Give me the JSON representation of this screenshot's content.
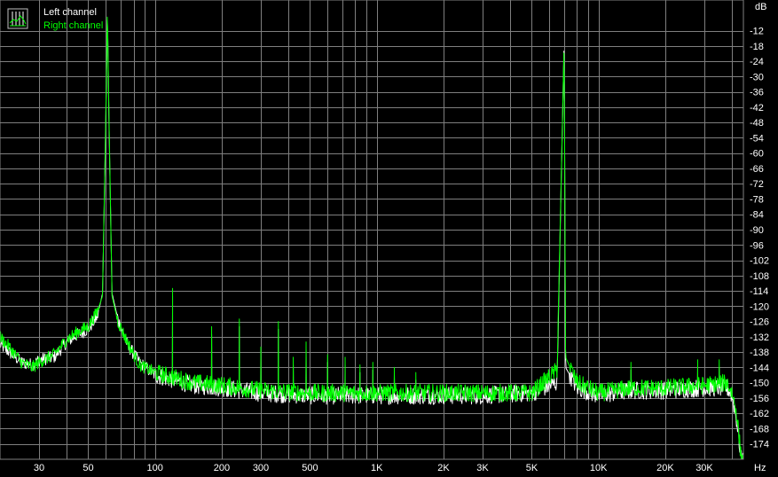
{
  "chart_data": {
    "type": "line",
    "x_scale": "log",
    "x_unit": "Hz",
    "y_unit": "dB",
    "xlim": [
      20,
      45000
    ],
    "ylim": [
      -180,
      0
    ],
    "grid": true,
    "legend_position": "top-left",
    "background": "#000000",
    "grid_color": "#7f7f7f",
    "x_ticks": [
      {
        "value": 30,
        "label": "30"
      },
      {
        "value": 50,
        "label": "50"
      },
      {
        "value": 100,
        "label": "100"
      },
      {
        "value": 200,
        "label": "200"
      },
      {
        "value": 300,
        "label": "300"
      },
      {
        "value": 500,
        "label": "500"
      },
      {
        "value": 1000,
        "label": "1K"
      },
      {
        "value": 2000,
        "label": "2K"
      },
      {
        "value": 3000,
        "label": "3K"
      },
      {
        "value": 5000,
        "label": "5K"
      },
      {
        "value": 10000,
        "label": "10K"
      },
      {
        "value": 20000,
        "label": "20K"
      },
      {
        "value": 30000,
        "label": "30K"
      }
    ],
    "y_ticks": [
      -12,
      -18,
      -24,
      -30,
      -36,
      -42,
      -48,
      -54,
      -60,
      -66,
      -72,
      -78,
      -84,
      -90,
      -96,
      -102,
      -108,
      -114,
      -120,
      -126,
      -132,
      -138,
      -144,
      -150,
      -156,
      -162,
      -168,
      -174
    ],
    "series": [
      {
        "name": "Left channel",
        "color": "#ffffff",
        "points": [
          [
            20,
            -135
          ],
          [
            22,
            -138
          ],
          [
            25,
            -142
          ],
          [
            28,
            -143
          ],
          [
            30,
            -141
          ],
          [
            35,
            -140
          ],
          [
            40,
            -134
          ],
          [
            45,
            -131
          ],
          [
            50,
            -129
          ],
          [
            55,
            -124
          ],
          [
            58,
            -115
          ],
          [
            60,
            -48
          ],
          [
            61,
            -4
          ],
          [
            62,
            -48
          ],
          [
            64,
            -115
          ],
          [
            68,
            -125
          ],
          [
            75,
            -135
          ],
          [
            85,
            -142
          ],
          [
            100,
            -147
          ],
          [
            150,
            -151
          ],
          [
            200,
            -152
          ],
          [
            300,
            -154
          ],
          [
            500,
            -155
          ],
          [
            1000,
            -155
          ],
          [
            2000,
            -155
          ],
          [
            3000,
            -155
          ],
          [
            5000,
            -154
          ],
          [
            6500,
            -150
          ],
          [
            7000,
            -15
          ],
          [
            7100,
            -144
          ],
          [
            8000,
            -152
          ],
          [
            10000,
            -155
          ],
          [
            14000,
            -153
          ],
          [
            20000,
            -153
          ],
          [
            30000,
            -152
          ],
          [
            38000,
            -152
          ],
          [
            40000,
            -155
          ],
          [
            42000,
            -165
          ],
          [
            44000,
            -180
          ]
        ]
      },
      {
        "name": "Right channel",
        "color": "#00ff00",
        "points": [
          [
            20,
            -132
          ],
          [
            22,
            -136
          ],
          [
            25,
            -142
          ],
          [
            28,
            -144
          ],
          [
            30,
            -142
          ],
          [
            35,
            -139
          ],
          [
            40,
            -133
          ],
          [
            45,
            -130
          ],
          [
            50,
            -128
          ],
          [
            55,
            -122
          ],
          [
            58,
            -116
          ],
          [
            60,
            -45
          ],
          [
            61,
            -3
          ],
          [
            62,
            -45
          ],
          [
            64,
            -116
          ],
          [
            68,
            -126
          ],
          [
            75,
            -134
          ],
          [
            85,
            -143
          ],
          [
            100,
            -146
          ],
          [
            150,
            -150
          ],
          [
            200,
            -151
          ],
          [
            300,
            -153
          ],
          [
            500,
            -154
          ],
          [
            1000,
            -154
          ],
          [
            2000,
            -154
          ],
          [
            3000,
            -154
          ],
          [
            5000,
            -154
          ],
          [
            6500,
            -145
          ],
          [
            7000,
            -16
          ],
          [
            7100,
            -140
          ],
          [
            8000,
            -150
          ],
          [
            10000,
            -154
          ],
          [
            14000,
            -152
          ],
          [
            20000,
            -152
          ],
          [
            30000,
            -151
          ],
          [
            38000,
            -150
          ],
          [
            40000,
            -154
          ],
          [
            42000,
            -162
          ],
          [
            44000,
            -180
          ]
        ]
      }
    ],
    "spurs": [
      {
        "f": 120,
        "db": -113
      },
      {
        "f": 180,
        "db": -129
      },
      {
        "f": 240,
        "db": -126
      },
      {
        "f": 300,
        "db": -136
      },
      {
        "f": 360,
        "db": -127
      },
      {
        "f": 420,
        "db": -141
      },
      {
        "f": 480,
        "db": -134
      },
      {
        "f": 600,
        "db": -140
      },
      {
        "f": 720,
        "db": -141
      },
      {
        "f": 840,
        "db": -143
      },
      {
        "f": 960,
        "db": -143
      },
      {
        "f": 1200,
        "db": -145
      },
      {
        "f": 1500,
        "db": -146
      },
      {
        "f": 14000,
        "db": -143
      },
      {
        "f": 28000,
        "db": -142
      },
      {
        "f": 35000,
        "db": -141
      }
    ]
  }
}
